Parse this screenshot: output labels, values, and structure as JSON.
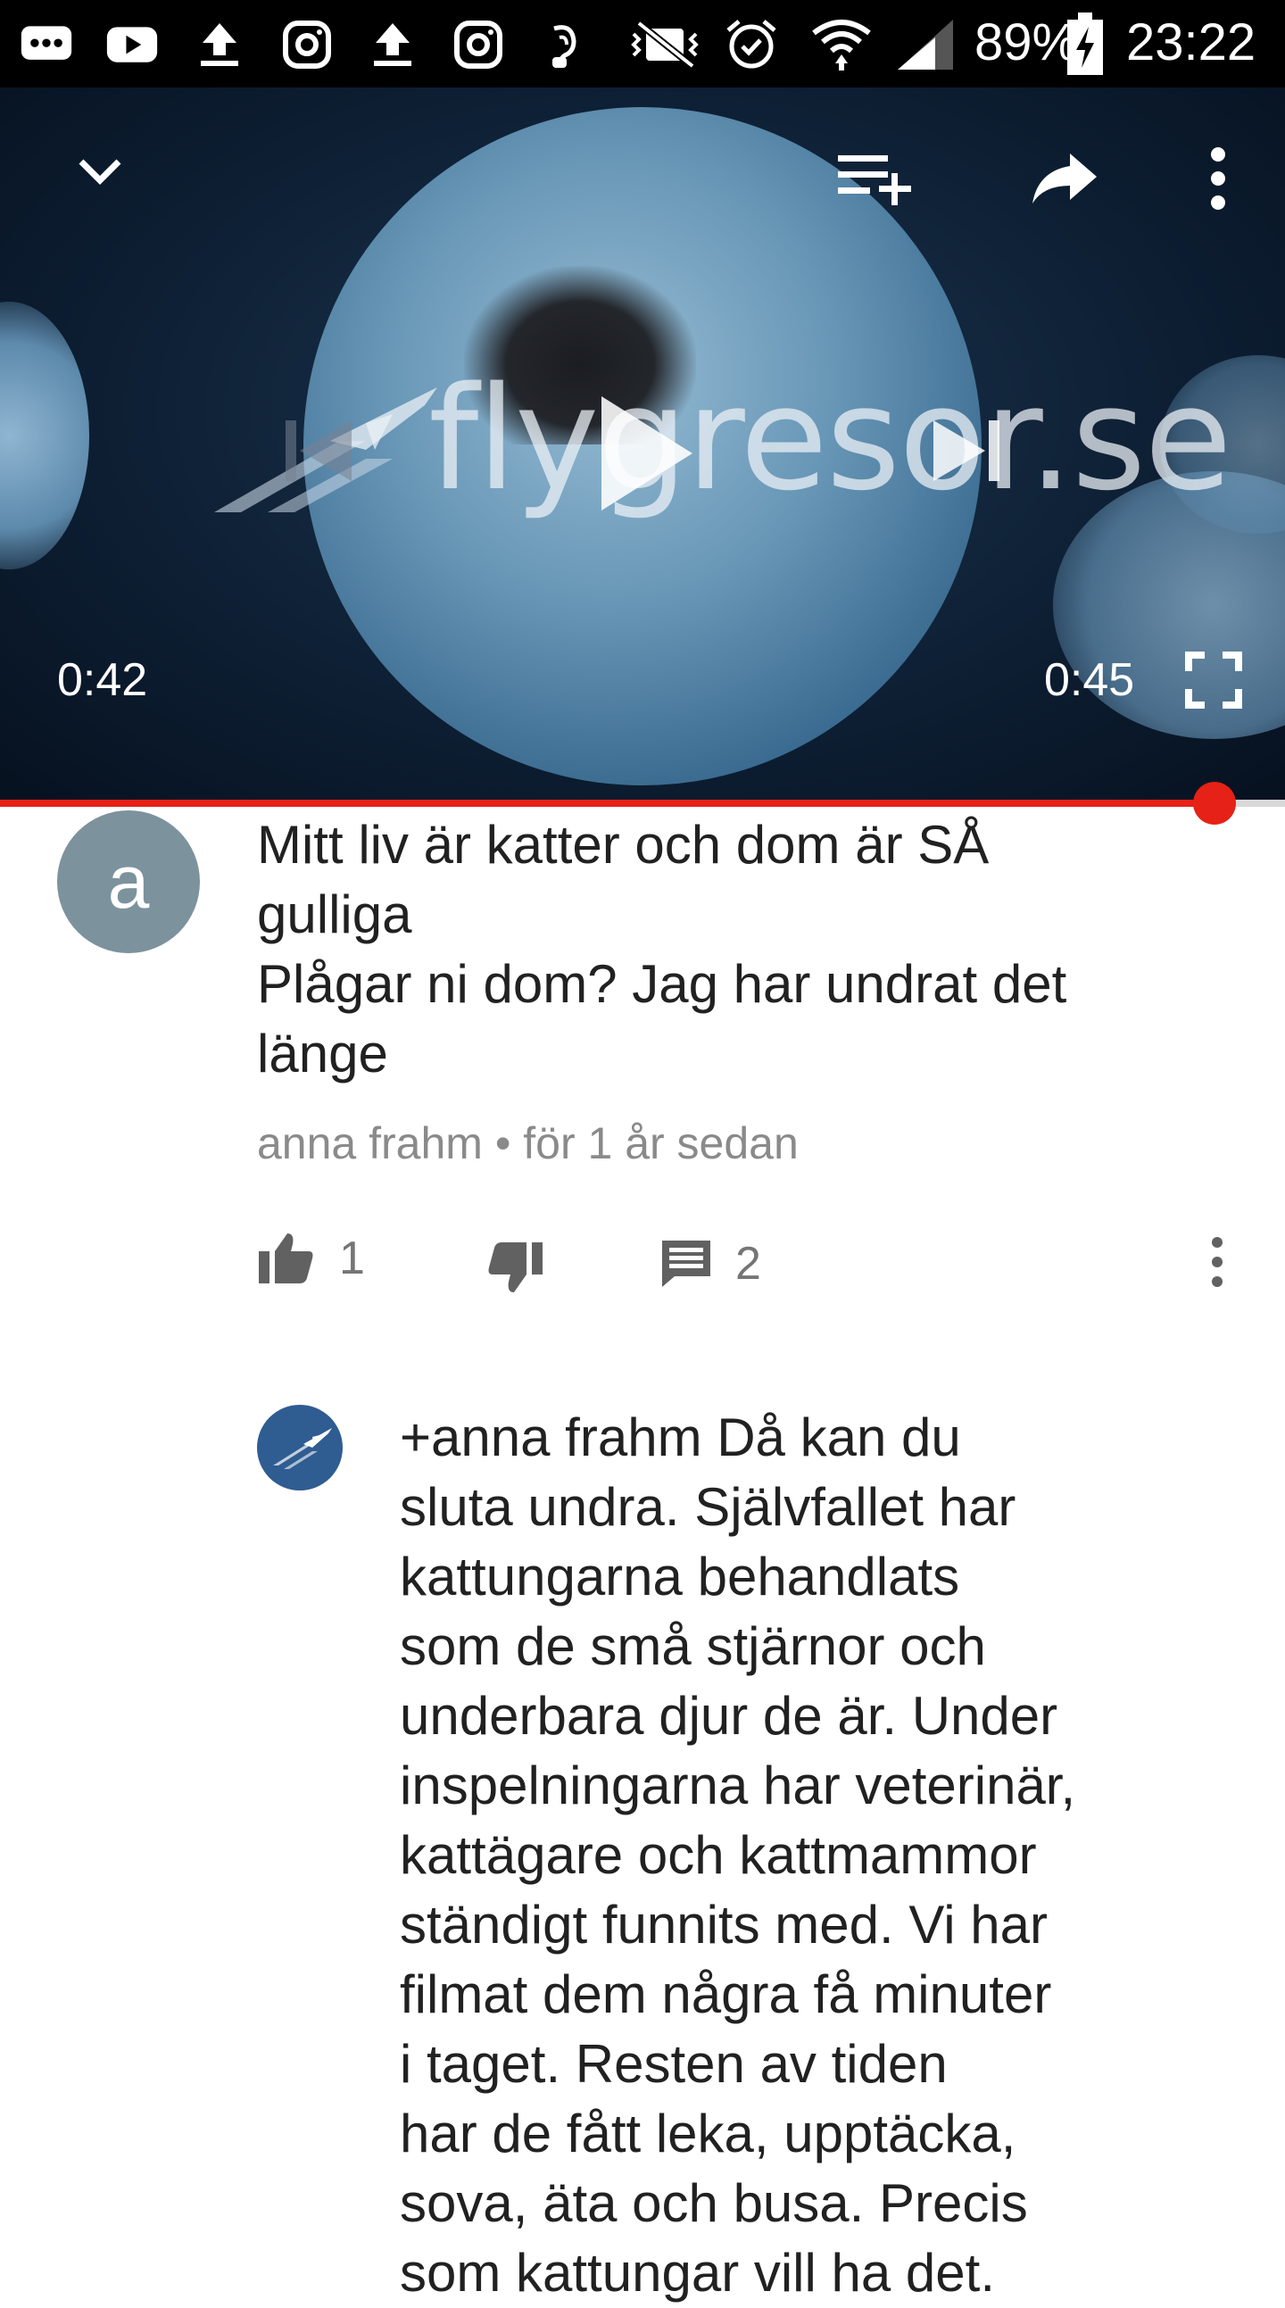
{
  "status_bar": {
    "battery": "89%",
    "time": "23:22",
    "icons": [
      "chat-icon",
      "youtube-icon",
      "upload-icon",
      "instagram-icon",
      "upload-icon",
      "instagram-icon",
      "nfc-icon",
      "mute-icon",
      "alarm-icon",
      "wifi-icon",
      "signal-icon",
      "battery-icon"
    ]
  },
  "player": {
    "watermark": "flygresor.se",
    "current_time": "0:42",
    "duration": "0:45",
    "progress": 0.945,
    "icons": {
      "collapse": "chevron-down-icon",
      "add_to_playlist": "playlist-add-icon",
      "share": "share-icon",
      "more": "more-vert-icon",
      "previous": "skip-previous-icon",
      "play": "play-icon",
      "next": "skip-next-icon",
      "fullscreen": "fullscreen-icon"
    }
  },
  "comment": {
    "avatar_letter": "a",
    "text": "Mitt liv är katter och dom är SÅ\ngulliga\nPlågar ni dom? Jag har undrat det\nlänge",
    "author": "anna frahm",
    "separator": "•",
    "age": "för 1 år sedan",
    "likes": "1",
    "replies": "2"
  },
  "reply": {
    "text": "+anna frahm Då kan du\nsluta undra. Självfallet har\nkattungarna behandlats\nsom de små stjärnor och\nunderbara djur de är. Under\ninspelningarna har veterinär,\nkattägare och kattmammor\nständigt funnits med. Vi har\nfilmat dem några få minuter\ni taget. Resten av tiden\nhar de fått leka, upptäcka,\nsova, äta och busa. Precis\nsom kattungar vill ha det."
  },
  "colors": {
    "accent_red": "#e62117",
    "avatar_grey": "#7c929d",
    "brand_blue": "#2f5c91"
  }
}
